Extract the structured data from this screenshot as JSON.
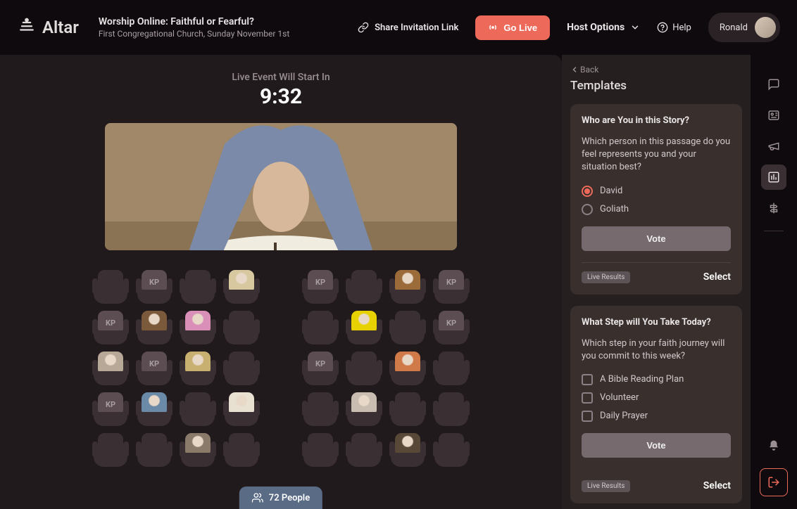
{
  "brand": "Altar",
  "event": {
    "title": "Worship Online: Faithful or Fearful?",
    "subtitle": "First Congregational Church, Sunday November 1st"
  },
  "header": {
    "share": "Share Invitation Link",
    "go_live": "Go Live",
    "host_options": "Host Options",
    "help": "Help",
    "user": "Ronald"
  },
  "stage": {
    "countdown_label": "Live Event Will Start In",
    "countdown_time": "9:32",
    "people_count": "72 People"
  },
  "seats": [
    [
      {
        "t": "e"
      },
      {
        "t": "kp"
      },
      {
        "t": "e"
      },
      {
        "t": "p",
        "c": "#d7c8a0"
      },
      {
        "t": "g"
      },
      {
        "t": "kp"
      },
      {
        "t": "e"
      },
      {
        "t": "p",
        "c": "#9b6b3a"
      },
      {
        "t": "kp"
      }
    ],
    [
      {
        "t": "kp"
      },
      {
        "t": "p",
        "c": "#7a5a3a"
      },
      {
        "t": "p",
        "c": "#d98fb8"
      },
      {
        "t": "e"
      },
      {
        "t": "g"
      },
      {
        "t": "e"
      },
      {
        "t": "p",
        "c": "#e7d100"
      },
      {
        "t": "e"
      },
      {
        "t": "kp"
      }
    ],
    [
      {
        "t": "p",
        "c": "#b8a898"
      },
      {
        "t": "kp"
      },
      {
        "t": "p",
        "c": "#c8b070"
      },
      {
        "t": "e"
      },
      {
        "t": "g"
      },
      {
        "t": "kp"
      },
      {
        "t": "e"
      },
      {
        "t": "p",
        "c": "#d07a4a"
      },
      {
        "t": "e"
      }
    ],
    [
      {
        "t": "kp"
      },
      {
        "t": "p",
        "c": "#6a8aa8"
      },
      {
        "t": "e"
      },
      {
        "t": "p",
        "c": "#e8e0d0"
      },
      {
        "t": "g"
      },
      {
        "t": "e"
      },
      {
        "t": "p",
        "c": "#c8bdb0"
      },
      {
        "t": "e"
      },
      {
        "t": "e"
      }
    ],
    [
      {
        "t": "e"
      },
      {
        "t": "e"
      },
      {
        "t": "p",
        "c": "#8a7a6a"
      },
      {
        "t": "e"
      },
      {
        "t": "g"
      },
      {
        "t": "e"
      },
      {
        "t": "e"
      },
      {
        "t": "p",
        "c": "#584838"
      },
      {
        "t": "e"
      }
    ]
  ],
  "sidebar": {
    "back": "Back",
    "title": "Templates",
    "vote_label": "Vote",
    "badge": "Live Results",
    "select": "Select",
    "templates": [
      {
        "title": "Who are You in this Story?",
        "question": "Which person in this passage do you feel represents you and your situation best?",
        "type": "radio",
        "options": [
          "David",
          "Goliath"
        ],
        "selected": 0
      },
      {
        "title": "What Step will You Take Today?",
        "question": "Which step in your faith journey will you commit to this week?",
        "type": "checkbox",
        "options": [
          "A Bible Reading Plan",
          "Volunteer",
          "Daily Prayer"
        ]
      }
    ]
  }
}
